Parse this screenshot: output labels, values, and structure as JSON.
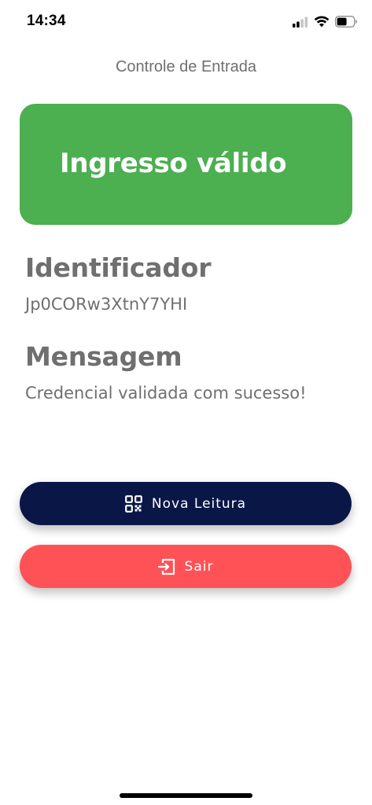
{
  "status_bar": {
    "time": "14:34",
    "icons": [
      "cellular-signal-icon",
      "wifi-icon",
      "battery-icon"
    ]
  },
  "header": {
    "title": "Controle de Entrada"
  },
  "result": {
    "text": "Ingresso válido",
    "color": "#4caf50"
  },
  "identifier": {
    "label": "Identificador",
    "value": "Jp0CORw3XtnY7YHI"
  },
  "message": {
    "label": "Mensagem",
    "value": "Credencial validada com sucesso!"
  },
  "actions": {
    "scan": {
      "label": "Nova Leitura",
      "icon": "qr-code-icon",
      "color": "#0a1746"
    },
    "exit": {
      "label": "Sair",
      "icon": "exit-icon",
      "color": "#ff5257"
    }
  }
}
